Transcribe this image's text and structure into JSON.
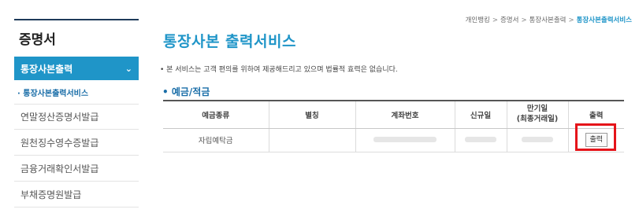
{
  "breadcrumb": [
    "개인뱅킹",
    "증명서",
    "통장사본출력",
    "통장사본출력서비스"
  ],
  "sidebar": {
    "title": "증명서",
    "active_item": "통장사본출력",
    "sub_item": "· 통장사본출력서비스",
    "items": [
      {
        "label": "연말정산증명서발급"
      },
      {
        "label": "원천징수영수증발급"
      },
      {
        "label": "금융거래확인서발급"
      },
      {
        "label": "부채증명원발급"
      }
    ]
  },
  "main": {
    "title": "통장사본 출력서비스",
    "notice": "• 본 서비스는 고객 편의를 위하여 제공해드리고 있으며 법률적 효력은 없습니다.",
    "section_title": "• 예금/적금"
  },
  "table": {
    "headers": [
      "예금종류",
      "별칭",
      "계좌번호",
      "신규일",
      "만기일",
      "(최종거래일)",
      "출력"
    ],
    "rows": [
      {
        "type": "자립예탁금",
        "print_label": "출력"
      }
    ]
  },
  "colors": {
    "accent": "#1f95c8",
    "highlight": "#e5141a"
  },
  "icons": {
    "active_chevron": "chevron-down-icon"
  }
}
